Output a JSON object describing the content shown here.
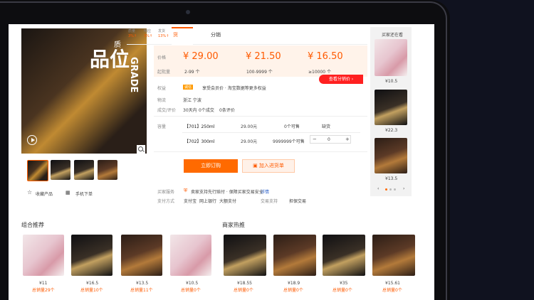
{
  "nav": {
    "tab_goods": "货",
    "tab_distribution": "分销"
  },
  "ratings": [
    {
      "label": "质量",
      "value": "3%↑"
    },
    {
      "label": "响应",
      "value": "3%↑"
    },
    {
      "label": "发货",
      "value": "13%↑"
    }
  ],
  "main_image_text": {
    "big": "品位",
    "side": "GRADE",
    "small": "质"
  },
  "price": {
    "label": "价格",
    "qty_label": "起批量",
    "tiers": [
      {
        "price": "¥ 29.00",
        "qty": "2-99 个"
      },
      {
        "price": "¥ 21.50",
        "qty": "100-9999 个"
      },
      {
        "price": "¥ 16.50",
        "qty": "≥10000 个"
      }
    ],
    "distribution_button": "查看分销价"
  },
  "info": {
    "benefit_label": "权益",
    "benefit_badge": "诚信",
    "benefit_text": "享受会员价 · 淘宝数据等更多权益",
    "logistics_label": "物流",
    "logistics_value": "浙江 宁波",
    "evaluation_label": "成交/评价",
    "evaluation_text1": "30天内",
    "evaluation_text2": "0个成交",
    "evaluation_text3": "0条评价"
  },
  "spec": {
    "label": "容量",
    "rows": [
      {
        "name": "【701】250ml",
        "price": "29.00元",
        "stock": "0个可售",
        "action": "缺货"
      },
      {
        "name": "【702】300ml",
        "price": "29.00元",
        "stock": "9999999个可售",
        "qty": "0"
      }
    ],
    "minus": "−",
    "plus": "+"
  },
  "actions": {
    "order": "立即订购",
    "add_cart": "加入进货单"
  },
  "service": {
    "label": "买家服务",
    "text": "卖家支持先行赔付 · 保障买家交易安全",
    "detail": "详情",
    "pay_label": "支付方式",
    "pay_items": [
      "支付宝",
      "网上银行",
      "大额支付"
    ],
    "trade_label": "交易支持",
    "trade_value": "担保交易"
  },
  "links": {
    "favorite": "收藏产品",
    "mobile": "手机下单"
  },
  "sidebar": {
    "title": "买家还在看",
    "items": [
      {
        "price": "¥10.5"
      },
      {
        "price": "¥22.3"
      },
      {
        "price": "¥13.5"
      }
    ]
  },
  "combo": {
    "title": "组合推荐",
    "items": [
      {
        "price": "¥11",
        "sales": "总销量29个"
      },
      {
        "price": "¥16.5",
        "sales": "总销量10个"
      },
      {
        "price": "¥13.5",
        "sales": "总销量11个"
      },
      {
        "price": "¥10.5",
        "sales": "总销量0个"
      }
    ]
  },
  "hot": {
    "title": "商家热推",
    "items": [
      {
        "price": "¥18.55",
        "sales": "总销量0个"
      },
      {
        "price": "¥18.9",
        "sales": "总销量0个"
      },
      {
        "price": "¥35",
        "sales": "总销量0个"
      },
      {
        "price": "¥15.61",
        "sales": "总销量0个"
      }
    ]
  }
}
